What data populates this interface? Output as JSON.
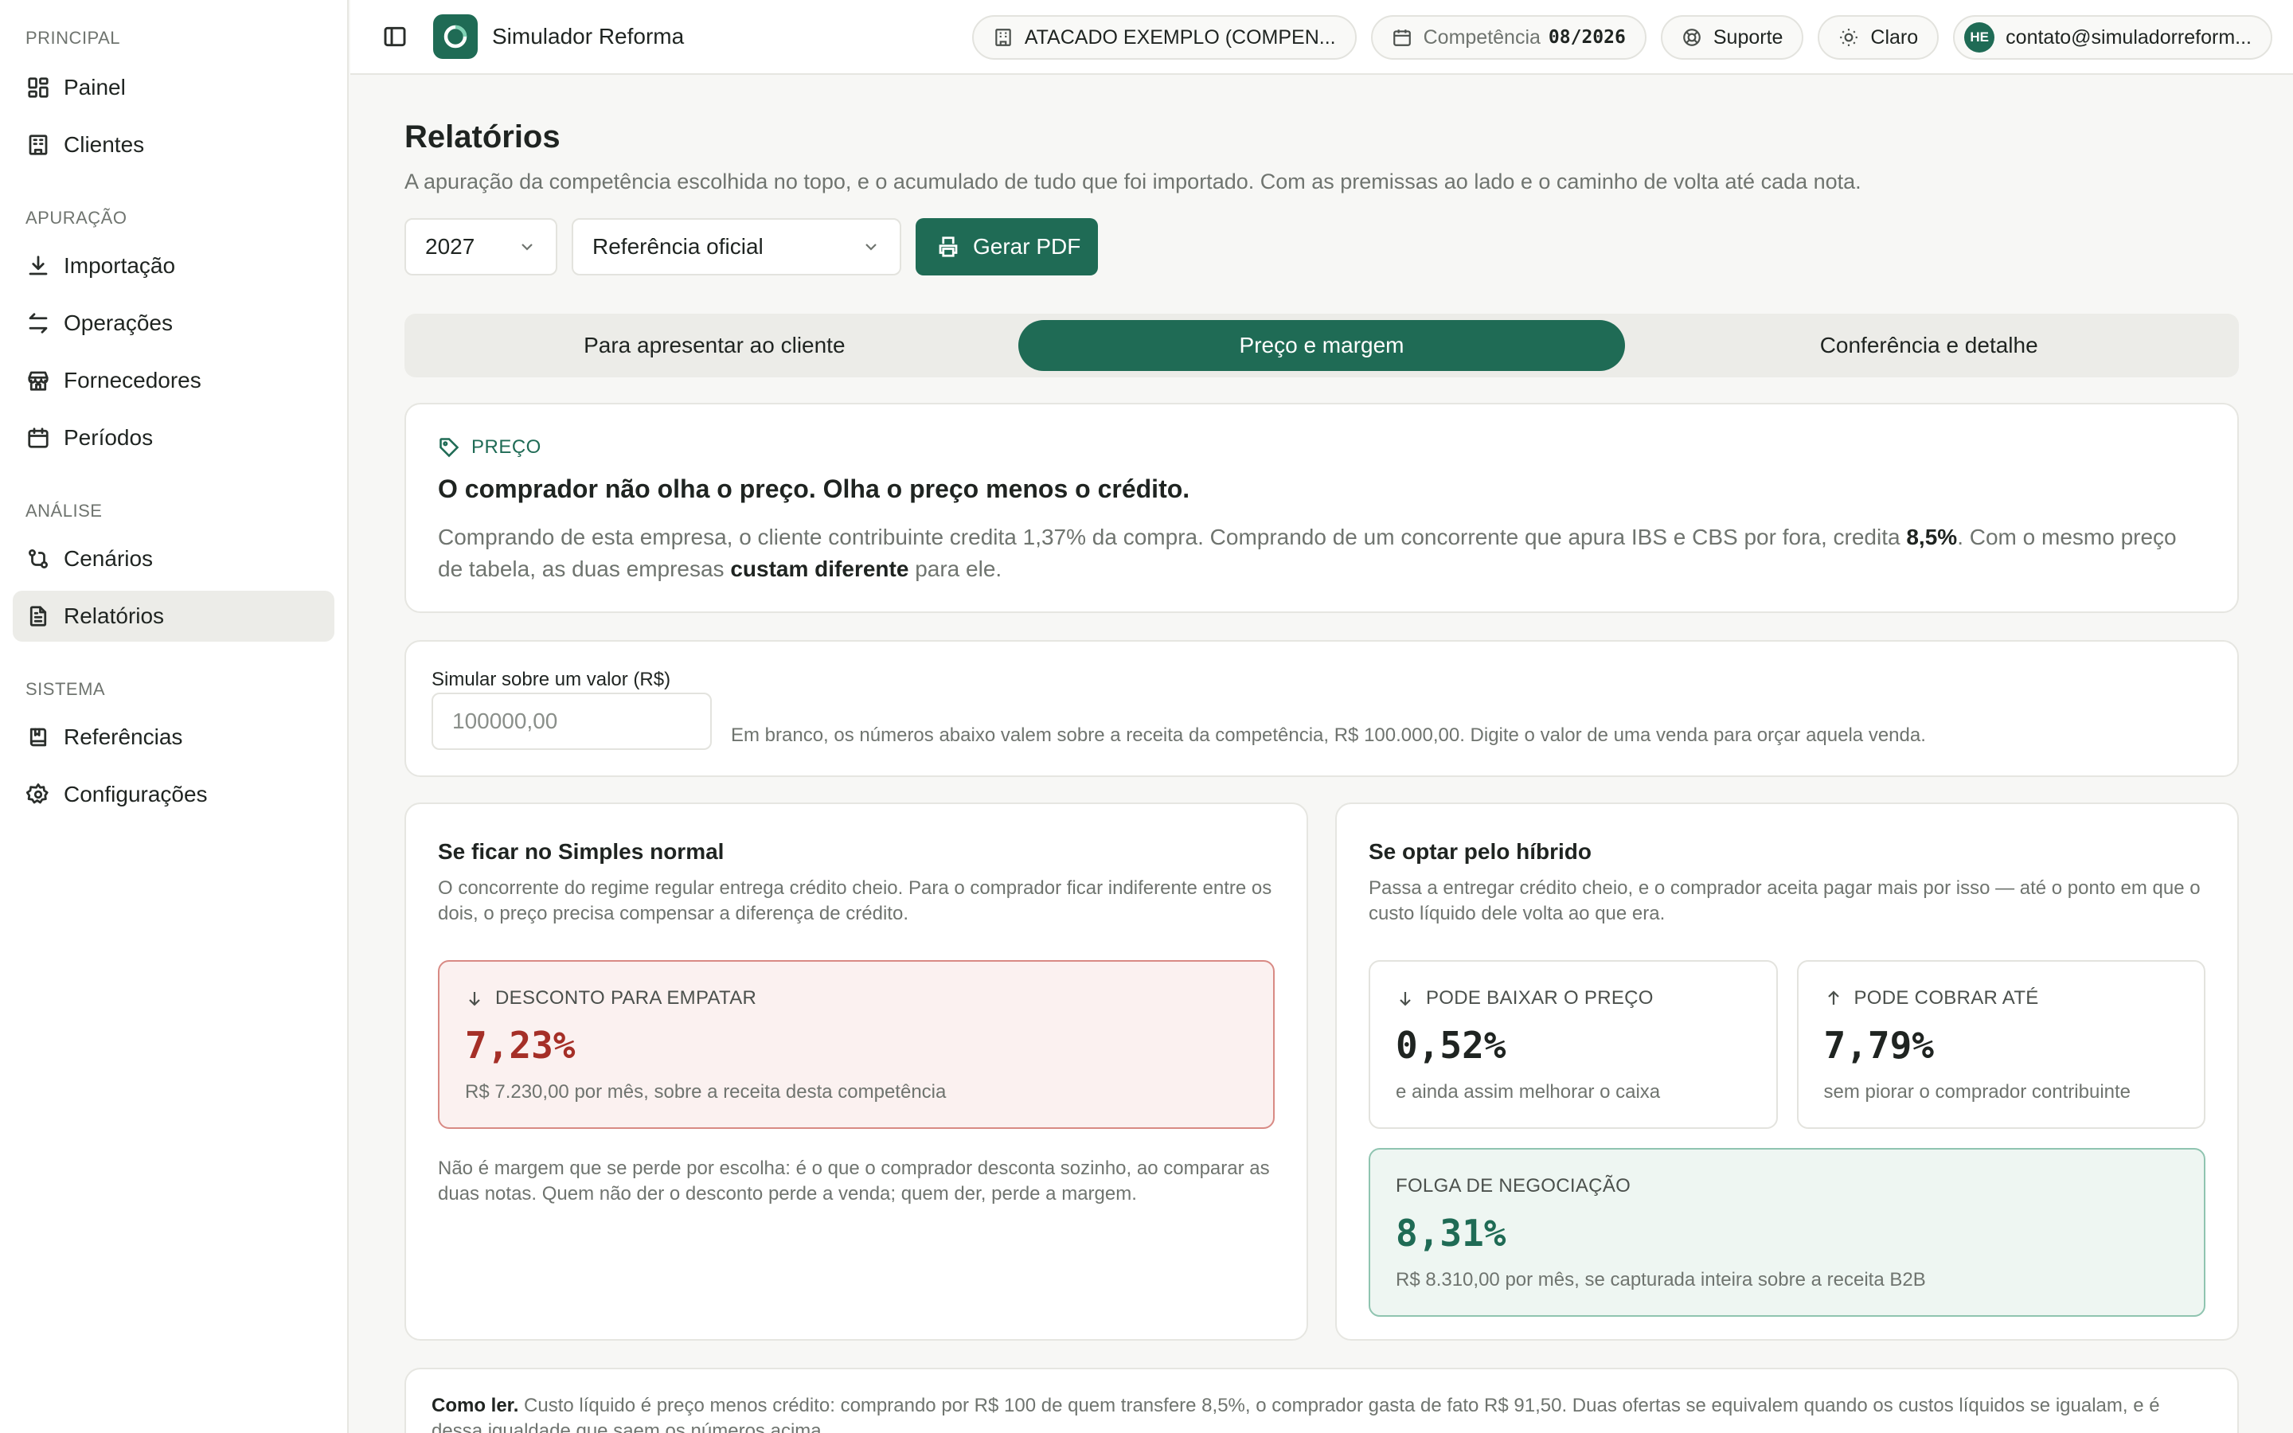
{
  "sidebar": {
    "groups": [
      {
        "title": "PRINCIPAL",
        "items": [
          {
            "label": "Painel"
          },
          {
            "label": "Clientes"
          }
        ]
      },
      {
        "title": "APURAÇÃO",
        "items": [
          {
            "label": "Importação"
          },
          {
            "label": "Operações"
          },
          {
            "label": "Fornecedores"
          },
          {
            "label": "Períodos"
          }
        ]
      },
      {
        "title": "ANÁLISE",
        "items": [
          {
            "label": "Cenários"
          },
          {
            "label": "Relatórios"
          }
        ]
      },
      {
        "title": "SISTEMA",
        "items": [
          {
            "label": "Referências"
          },
          {
            "label": "Configurações"
          }
        ]
      }
    ]
  },
  "topbar": {
    "app_title": "Simulador Reforma",
    "company": "ATACADO EXEMPLO (COMPEN...",
    "competencia_label": "Competência",
    "competencia_value": "08/2026",
    "support": "Suporte",
    "theme": "Claro",
    "avatar": "HE",
    "user_email": "contato@simuladorreform..."
  },
  "page": {
    "title": "Relatórios",
    "subtitle": "A apuração da competência escolhida no topo, e o acumulado de tudo que foi importado. Com as premissas ao lado e o caminho de volta até cada nota.",
    "year_select": "2027",
    "reference_select": "Referência oficial",
    "pdf_button": "Gerar PDF"
  },
  "tabs": [
    {
      "label": "Para apresentar ao cliente",
      "active": false
    },
    {
      "label": "Preço e margem",
      "active": true
    },
    {
      "label": "Conferência e detalhe",
      "active": false
    }
  ],
  "price_card": {
    "tag": "PREÇO",
    "headline": "O comprador não olha o preço. Olha o preço menos o crédito.",
    "body_1": "Comprando de esta empresa, o cliente contribuinte credita 1,37% da compra. Comprando de um concorrente que apura IBS e CBS por fora, credita ",
    "body_bold_1": "8,5%",
    "body_2": ". Com o mesmo preço de tabela, as duas empresas ",
    "body_bold_2": "custam diferente",
    "body_3": " para ele."
  },
  "simulator": {
    "label": "Simular sobre um valor (R$)",
    "placeholder": "100000,00",
    "hint": "Em branco, os números abaixo valem sobre a receita da competência, R$ 100.000,00. Digite o valor de uma venda para orçar aquela venda."
  },
  "simples": {
    "title": "Se ficar no Simples normal",
    "desc": "O concorrente do regime regular entrega crédito cheio. Para o comprador ficar indiferente entre os dois, o preço precisa compensar a diferença de crédito.",
    "metric_label": "DESCONTO PARA EMPATAR",
    "metric_value": "7,23%",
    "metric_note": "R$ 7.230,00 por mês, sobre a receita desta competência",
    "foot": "Não é margem que se perde por escolha: é o que o comprador desconta sozinho, ao comparar as duas notas. Quem não der o desconto perde a venda; quem der, perde a margem."
  },
  "hibrido": {
    "title": "Se optar pelo híbrido",
    "desc": "Passa a entregar crédito cheio, e o comprador aceita pagar mais por isso — até o ponto em que o custo líquido dele volta ao que era.",
    "lower_label": "PODE BAIXAR O PREÇO",
    "lower_value": "0,52%",
    "lower_note": "e ainda assim melhorar o caixa",
    "raise_label": "PODE COBRAR ATÉ",
    "raise_value": "7,79%",
    "raise_note": "sem piorar o comprador contribuinte",
    "slack_label": "FOLGA DE NEGOCIAÇÃO",
    "slack_value": "8,31%",
    "slack_note": "R$ 8.310,00 por mês, se capturada inteira sobre a receita B2B"
  },
  "howto": {
    "bold": "Como ler.",
    "text": " Custo líquido é preço menos crédito: comprando por R$ 100 de quem transfere 8,5%, o comprador gasta de fato R$ 91,50. Duas ofertas se equivalem quando os custos líquidos se igualam, e é dessa igualdade que saem os números acima."
  },
  "colors": {
    "accent": "#1f6b55",
    "danger": "#a52f27"
  }
}
